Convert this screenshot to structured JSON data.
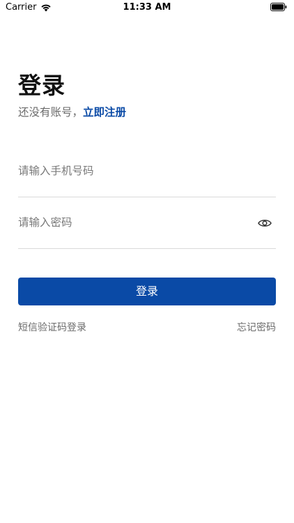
{
  "status_bar": {
    "carrier": "Carrier",
    "time": "11:33 AM",
    "icons": [
      "wifi-icon",
      "battery-icon"
    ]
  },
  "page": {
    "title": "登录",
    "register_prompt": "还没有账号，",
    "register_link": "立即注册"
  },
  "form": {
    "phone_placeholder": "请输入手机号码",
    "phone_value": "",
    "password_placeholder": "请输入密码",
    "password_value": "",
    "password_toggle_icon": "eye-icon",
    "submit_label": "登录"
  },
  "links": {
    "sms_login": "短信验证码登录",
    "forgot_password": "忘记密码"
  },
  "colors": {
    "accent": "#0a4aa6",
    "secondary_text": "#6b6b6b",
    "divider": "#d9d9d9"
  }
}
